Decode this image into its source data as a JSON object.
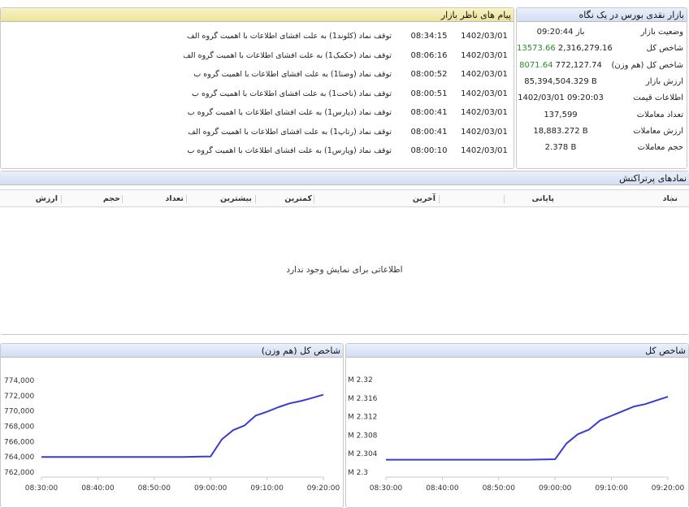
{
  "summary": {
    "title": "بازار نقدی بورس در یک نگاه",
    "rows": [
      {
        "label": "وضعیت بازار",
        "value": "باز 09:20:44",
        "accent": ""
      },
      {
        "label": "شاخص کل",
        "value": "2,316,279.16",
        "accent": "13573.66"
      },
      {
        "label": "شاخص کل (هم وزن)",
        "value": "772,127.74",
        "accent": "8071.64"
      },
      {
        "label": "ارزش بازار",
        "value": "85,394,504.329 B",
        "accent": ""
      },
      {
        "label": "اطلاعات قیمت",
        "value": "1402/03/01 09:20:03",
        "accent": ""
      },
      {
        "label": "تعداد معاملات",
        "value": "137,599",
        "accent": ""
      },
      {
        "label": "ارزش معاملات",
        "value": "18,883.272 B",
        "accent": ""
      },
      {
        "label": "حجم معاملات",
        "value": "2.378 B",
        "accent": ""
      }
    ],
    "accent_color": "#2a8a2a"
  },
  "messages": {
    "title": "پیام های ناظر بازار",
    "items": [
      {
        "date": "1402/03/01",
        "time": "08:34:15",
        "text": "توقف نماد (کلوند1) به علت افشای اطلاعات با اهمیت گروه الف"
      },
      {
        "date": "1402/03/01",
        "time": "08:06:16",
        "text": "توقف نماد (حکمک1) به علت افشای اطلاعات با اهمیت گروه الف"
      },
      {
        "date": "1402/03/01",
        "time": "08:00:52",
        "text": "توقف نماد (وصنا1) به علت افشای اطلاعات با اهمیت گروه ب"
      },
      {
        "date": "1402/03/01",
        "time": "08:00:51",
        "text": "توقف نماد (ناخت1) به علت افشای اطلاعات با اهمیت گروه ب"
      },
      {
        "date": "1402/03/01",
        "time": "08:00:41",
        "text": "توقف نماد (دپارس1) به علت افشای اطلاعات با اهمیت گروه ب"
      },
      {
        "date": "1402/03/01",
        "time": "08:00:41",
        "text": "توقف نماد (رتاپ1) به علت افشای اطلاعات با اهمیت گروه الف"
      },
      {
        "date": "1402/03/01",
        "time": "08:00:10",
        "text": "توقف نماد (وپارس1) به علت افشای اطلاعات با اهمیت گروه ب"
      }
    ]
  },
  "symbols": {
    "title": "نمادهای پرتراکنش",
    "columns": [
      "نماد",
      "پایانی",
      "آخرین",
      "کمترین",
      "بیشترین",
      "تعداد",
      "حجم",
      "ارزش"
    ],
    "empty_message": "اطلاعاتی برای نمایش وجود ندارد"
  },
  "chart_data": [
    {
      "type": "line",
      "title": "شاخص کل (هم وزن)",
      "x_ticks": [
        "08:30:00",
        "08:40:00",
        "08:50:00",
        "09:00:00",
        "09:10:00",
        "09:20:00"
      ],
      "y_ticks": [
        "774,000",
        "772,000",
        "770,000",
        "768,000",
        "766,000",
        "764,000",
        "762,000"
      ],
      "ylim": [
        762000,
        774000
      ],
      "series_color": "#3b3bd4",
      "x": [
        "08:30",
        "08:35",
        "08:40",
        "08:45",
        "08:50",
        "08:55",
        "09:00",
        "09:02",
        "09:04",
        "09:06",
        "09:08",
        "09:10",
        "09:12",
        "09:14",
        "09:16",
        "09:18",
        "09:20"
      ],
      "values": [
        764000,
        764000,
        764000,
        764000,
        764000,
        764000,
        764056,
        766300,
        767500,
        768100,
        769400,
        769900,
        770500,
        771000,
        771300,
        771700,
        772128
      ]
    },
    {
      "type": "line",
      "title": "شاخص کل",
      "x_ticks": [
        "08:30:00",
        "08:40:00",
        "08:50:00",
        "09:00:00",
        "09:10:00",
        "09:20:00"
      ],
      "y_ticks": [
        "M 2.32",
        "M 2.316",
        "M 2.312",
        "M 2.308",
        "M 2.304",
        "M 2.3"
      ],
      "ylim": [
        2.3,
        2.32
      ],
      "series_color": "#3b3bd4",
      "x": [
        "08:30",
        "08:35",
        "08:40",
        "08:45",
        "08:50",
        "08:55",
        "09:00",
        "09:02",
        "09:04",
        "09:06",
        "09:08",
        "09:10",
        "09:12",
        "09:14",
        "09:16",
        "09:18",
        "09:20"
      ],
      "values": [
        2.3027,
        2.3027,
        2.3027,
        2.3027,
        2.3027,
        2.3027,
        2.3028,
        2.3062,
        2.3082,
        2.3092,
        2.3112,
        2.3122,
        2.3132,
        2.3142,
        2.3147,
        2.3155,
        2.3163
      ]
    }
  ]
}
